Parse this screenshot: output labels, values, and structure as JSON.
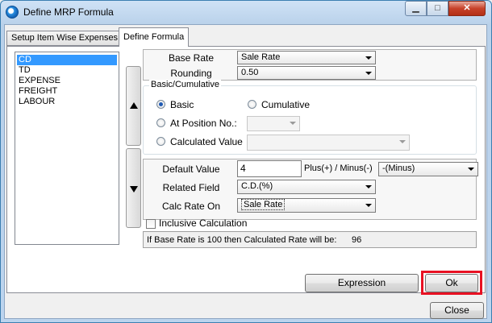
{
  "window": {
    "title": "Define MRP Formula",
    "min_symbol": "▁",
    "max_symbol": "□",
    "close_symbol": "✕"
  },
  "tabs": [
    {
      "label": "Setup Item Wise Expenses"
    },
    {
      "label": "Define Formula"
    }
  ],
  "expenses": [
    "CD",
    "TD",
    "EXPENSE",
    "FREIGHT",
    "LABOUR"
  ],
  "form": {
    "base_rate": {
      "label": "Base Rate",
      "value": "Sale Rate"
    },
    "rounding": {
      "label": "Rounding",
      "value": "0.50"
    },
    "basic_cumulative": {
      "label": "Basic/Cumulative",
      "basic": "Basic",
      "cumulative": "Cumulative",
      "at_position": "At Position No.:",
      "calculated_value": "Calculated Value"
    },
    "default_value": {
      "label": "Default Value",
      "value": "4"
    },
    "plus_minus": {
      "label": "Plus(+) / Minus(-)",
      "value": "-(Minus)"
    },
    "related_field": {
      "label": "Related Field",
      "value": "C.D.(%)"
    },
    "calc_rate_on": {
      "label": "Calc Rate On",
      "value": "Sale Rate"
    },
    "inclusive": {
      "label": "Inclusive Calculation",
      "checked": false
    },
    "result": {
      "text": "If Base Rate is 100 then Calculated Rate will be:",
      "value": "96"
    }
  },
  "buttons": {
    "expression": "Expression",
    "ok": "Ok",
    "close": "Close"
  },
  "colors": {
    "highlight": "#e81123",
    "selection": "#3399ff"
  }
}
